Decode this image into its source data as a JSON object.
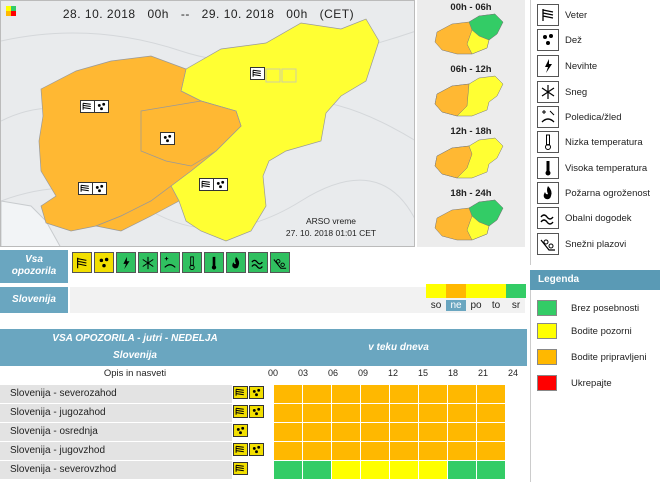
{
  "map": {
    "date_from": "28. 10. 2018",
    "time_from": "00h",
    "sep": "--",
    "date_to": "29. 10. 2018",
    "time_to": "00h",
    "tz": "(CET)",
    "stamp_line1": "ARSO vreme",
    "stamp_line2": "27. 10. 2018   01:01 CET"
  },
  "mini_maps": [
    {
      "label": "00h - 06h"
    },
    {
      "label": "06h - 12h"
    },
    {
      "label": "12h - 18h"
    },
    {
      "label": "18h - 24h"
    }
  ],
  "icon_legend": [
    {
      "icon": "wind-icon",
      "label": "Veter"
    },
    {
      "icon": "rain-icon",
      "label": "Dež"
    },
    {
      "icon": "thunderstorm-icon",
      "label": "Nevihte"
    },
    {
      "icon": "snow-icon",
      "label": "Sneg"
    },
    {
      "icon": "ice-icon",
      "label": "Poledica/žled"
    },
    {
      "icon": "low-temperature-icon",
      "label": "Nizka temperatura"
    },
    {
      "icon": "high-temperature-icon",
      "label": "Visoka temperatura"
    },
    {
      "icon": "fire-icon",
      "label": "Požarna ogroženost"
    },
    {
      "icon": "coastal-icon",
      "label": "Obalni dogodek"
    },
    {
      "icon": "avalanche-icon",
      "label": "Snežni plazovi"
    }
  ],
  "legend": {
    "title": "Legenda",
    "items": [
      {
        "color": "#33cc66",
        "label": "Brez posebnosti"
      },
      {
        "color": "#ffff00",
        "label": "Bodite pozorni"
      },
      {
        "color": "#ffb800",
        "label": "Bodite pripravljeni"
      },
      {
        "color": "#ff0000",
        "label": "Ukrepajte"
      }
    ]
  },
  "band1": {
    "label_line1": "Vsa",
    "label_line2": "opozorila"
  },
  "band2": {
    "label": "Slovenija"
  },
  "days": [
    {
      "label": "so",
      "color": "#ffff00"
    },
    {
      "label": "ne",
      "color": "#ffb800",
      "selected": true
    },
    {
      "label": "po",
      "color": "#ffff00"
    },
    {
      "label": "to",
      "color": "#ffff00"
    },
    {
      "label": "sr",
      "color": "#33cc66"
    }
  ],
  "table": {
    "title": "VSA OPOZORILA - jutri - NEDELJA",
    "subtitle": "Slovenija",
    "timeline_title": "v teku dneva",
    "col_opis": "Opis in nasveti",
    "hours": [
      "00",
      "03",
      "06",
      "09",
      "12",
      "15",
      "18",
      "21",
      "24"
    ],
    "rows": [
      {
        "name": "Slovenija - severozahod",
        "icons": [
          "wind-icon",
          "rain-icon"
        ],
        "cells": [
          "O",
          "O",
          "O",
          "O",
          "O",
          "O",
          "O",
          "O"
        ]
      },
      {
        "name": "Slovenija - jugozahod",
        "icons": [
          "wind-icon",
          "rain-icon"
        ],
        "cells": [
          "O",
          "O",
          "O",
          "O",
          "O",
          "O",
          "O",
          "O"
        ]
      },
      {
        "name": "Slovenija - osrednja",
        "icons": [
          "rain-icon"
        ],
        "cells": [
          "O",
          "O",
          "O",
          "O",
          "O",
          "O",
          "O",
          "O"
        ]
      },
      {
        "name": "Slovenija - jugovzhod",
        "icons": [
          "wind-icon",
          "rain-icon"
        ],
        "cells": [
          "O",
          "O",
          "O",
          "O",
          "O",
          "O",
          "O",
          "O"
        ]
      },
      {
        "name": "Slovenija - severovzhod",
        "icons": [
          "wind-icon"
        ],
        "cells": [
          "G",
          "G",
          "Y",
          "Y",
          "Y",
          "Y",
          "G",
          "G"
        ]
      }
    ],
    "cell_colors": {
      "O": "#ffb800",
      "Y": "#ffff00",
      "G": "#33cc66"
    }
  }
}
